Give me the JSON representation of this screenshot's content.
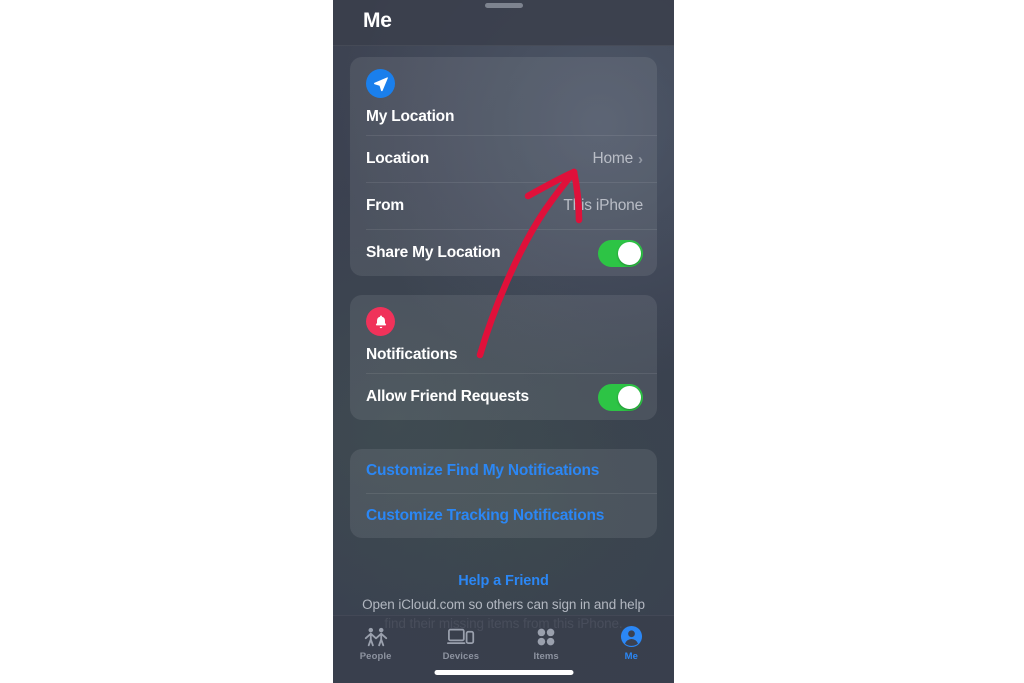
{
  "app": {
    "screen_background": "#3b4151",
    "accent_blue": "#2b87f5",
    "toggle_green": "#2dc445",
    "badge_red": "#f0325a",
    "badge_blue": "#1a7fec"
  },
  "header": {
    "title": "Me",
    "grabber": "sheet-grabber"
  },
  "my_location_card": {
    "icon": "location-arrow-icon",
    "title": "My Location",
    "rows": [
      {
        "label": "Location",
        "value": "Home",
        "chevron": "›",
        "type": "disclosure"
      },
      {
        "label": "From",
        "value": "This iPhone",
        "type": "value"
      },
      {
        "label": "Share My Location",
        "toggle_state": "on",
        "type": "toggle"
      }
    ]
  },
  "notifications_card": {
    "icon": "bell-icon",
    "title": "Notifications",
    "rows": [
      {
        "label": "Allow Friend Requests",
        "toggle_state": "on",
        "type": "toggle"
      }
    ]
  },
  "customize_card": {
    "links": [
      {
        "label": "Customize Find My Notifications"
      },
      {
        "label": "Customize Tracking Notifications"
      }
    ]
  },
  "footer": {
    "link": "Help a Friend",
    "note": "Open iCloud.com so others can sign in and help find their missing items from this iPhone."
  },
  "tabbar": {
    "tabs": [
      {
        "label": "People",
        "icon": "people-icon",
        "active": false
      },
      {
        "label": "Devices",
        "icon": "devices-icon",
        "active": false
      },
      {
        "label": "Items",
        "icon": "items-grid-icon",
        "active": false
      },
      {
        "label": "Me",
        "icon": "person-circle-icon",
        "active": true
      }
    ]
  },
  "annotation": {
    "type": "red-curved-arrow",
    "color": "#e0103a",
    "points_to": "Home",
    "description": "Hand-drawn red arrow curving up from near the Notifications title to the Location row value"
  }
}
